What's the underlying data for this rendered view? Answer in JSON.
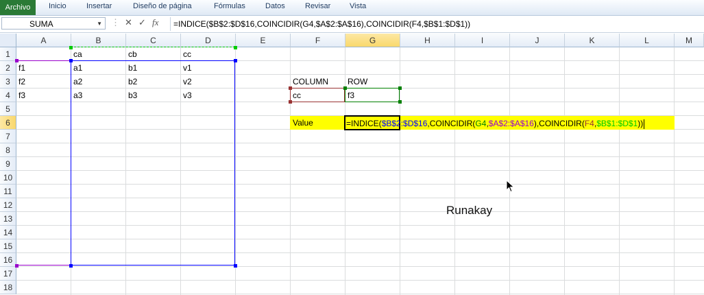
{
  "ribbon": {
    "file_tab": "Archivo",
    "tabs": [
      "Inicio",
      "Insertar",
      "Diseño de página",
      "Fórmulas",
      "Datos",
      "Revisar",
      "Vista"
    ]
  },
  "formula_bar": {
    "name_box": "SUMA",
    "cancel_icon": "x-icon",
    "enter_icon": "check-icon",
    "function_icon": "fx-icon",
    "formula": "=INDICE($B$2:$D$16,COINCIDIR(G4,$A$2:$A$16),COINCIDIR(F4,$B$1:$D$1))"
  },
  "sheet": {
    "columns": [
      "A",
      "B",
      "C",
      "D",
      "E",
      "F",
      "G",
      "H",
      "I",
      "J",
      "K",
      "L",
      "M"
    ],
    "rows": [
      "1",
      "2",
      "3",
      "4",
      "5",
      "6",
      "7",
      "8",
      "9",
      "10",
      "11",
      "12",
      "13",
      "14",
      "15",
      "16",
      "17",
      "18"
    ],
    "selected_column": "G",
    "selected_row": "6",
    "cells": {
      "B1": "ca",
      "C1": "cb",
      "D1": "cc",
      "A2": "f1",
      "B2": "a1",
      "C2": "b1",
      "D2": "v1",
      "A3": "f2",
      "B3": "a2",
      "C3": "b2",
      "D3": "v2",
      "A4": "f3",
      "B4": "a3",
      "C4": "b3",
      "D4": "v3",
      "F3": "COLUMN",
      "G3": "ROW",
      "F4": "cc",
      "G4": "f3",
      "F6": "Value"
    },
    "edit_formula_parts": [
      {
        "text": "=INDICE(",
        "color": "#000000"
      },
      {
        "text": "$B$2:$D$16",
        "color": "#0000ff"
      },
      {
        "text": ",COINCIDIR(",
        "color": "#000000"
      },
      {
        "text": "G4",
        "color": "#008000"
      },
      {
        "text": ",",
        "color": "#000000"
      },
      {
        "text": "$A$2:$A$16",
        "color": "#9900cc"
      },
      {
        "text": "),COINCIDIR(",
        "color": "#000000"
      },
      {
        "text": "F4",
        "color": "#993333"
      },
      {
        "text": ",",
        "color": "#000000"
      },
      {
        "text": "$B$1:$D$1",
        "color": "#00cc00"
      },
      {
        "text": "))",
        "color": "#000000"
      }
    ],
    "highlight_color": "#ffff00"
  },
  "watermark": "Runakay"
}
